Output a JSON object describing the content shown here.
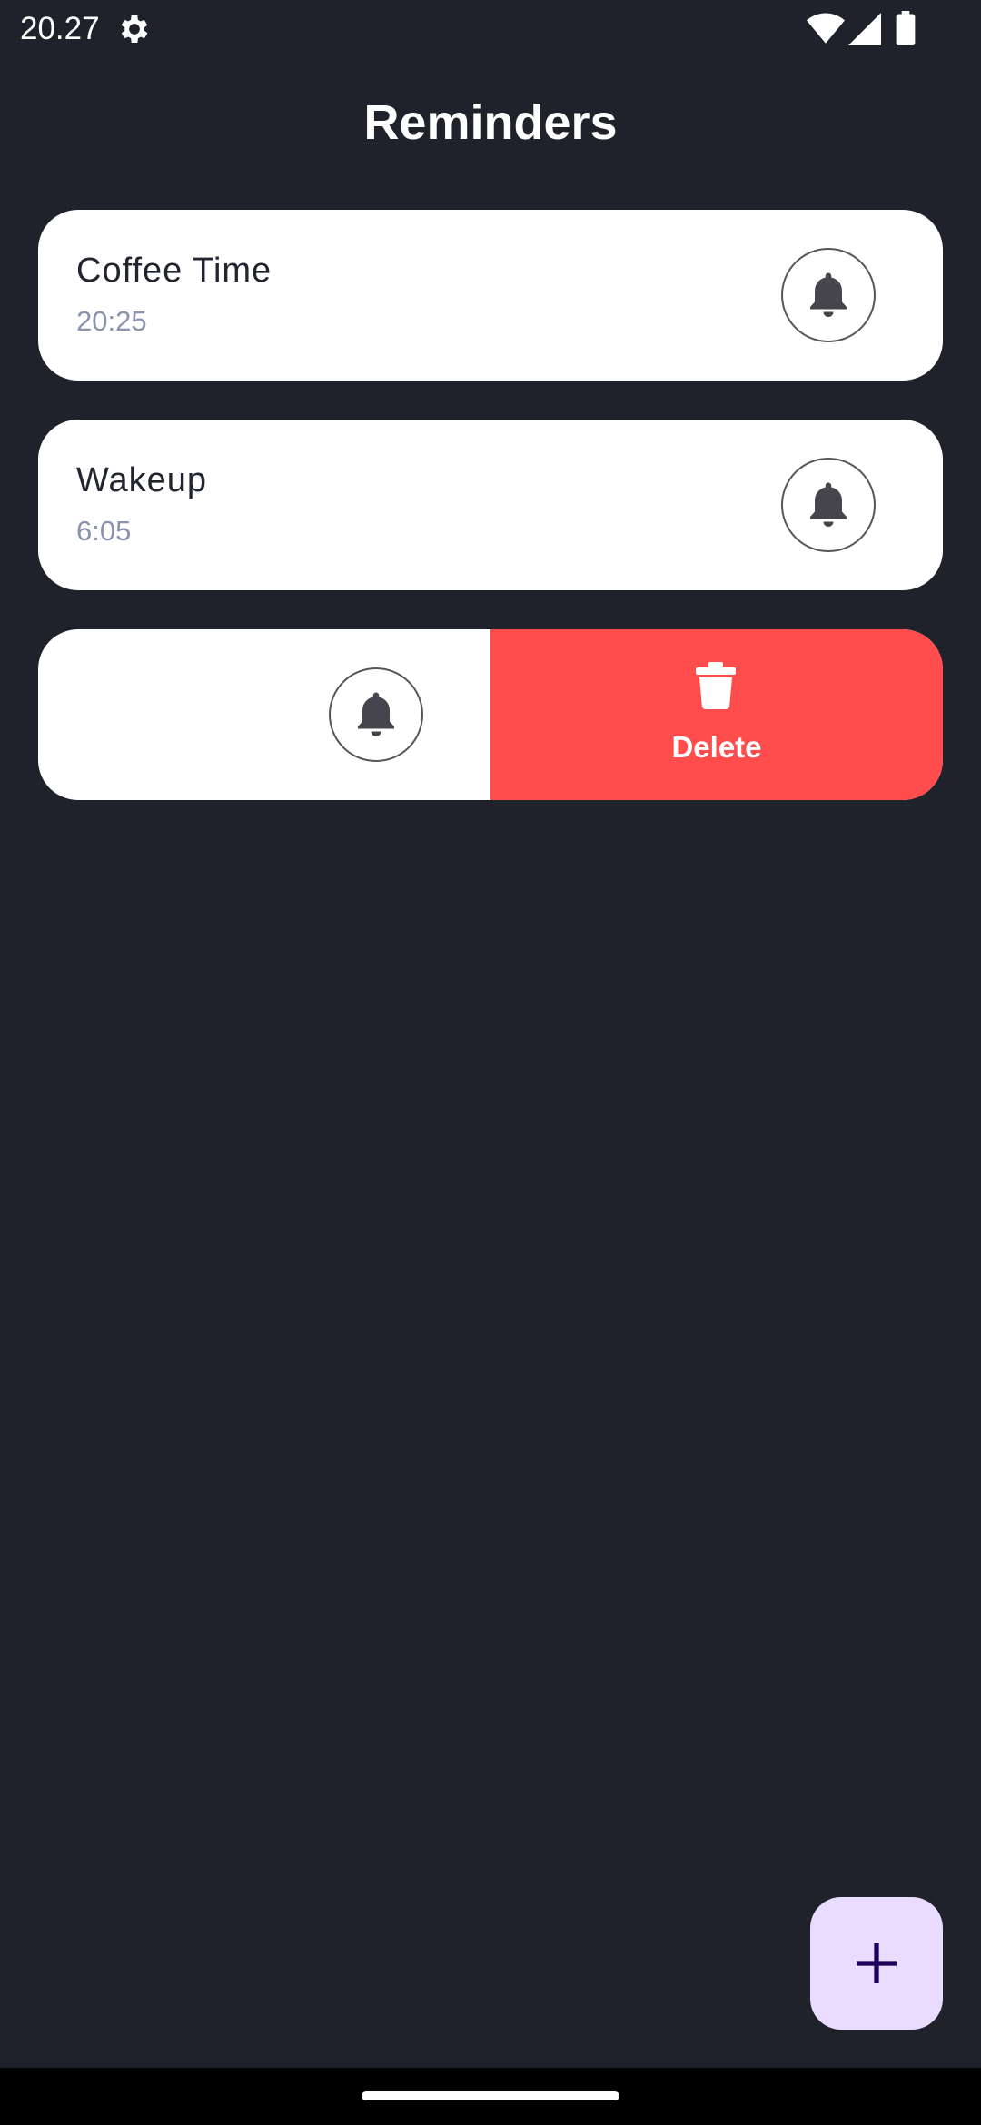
{
  "status_bar": {
    "time": "20.27",
    "icons": [
      "settings-gear-icon",
      "wifi-icon",
      "cellular-signal-icon",
      "battery-icon"
    ]
  },
  "header": {
    "title": "Reminders"
  },
  "reminders": [
    {
      "name": "Coffee Time",
      "time": "20:25",
      "icon": "bell-icon"
    },
    {
      "name": "Wakeup",
      "time": "6:05",
      "icon": "bell-icon"
    },
    {
      "name": "",
      "time": "",
      "icon": "bell-icon",
      "swiped": true
    }
  ],
  "swipe_action": {
    "label": "Delete",
    "icon": "trash-icon",
    "color": "#ff4c4c"
  },
  "fab": {
    "icon": "plus-icon",
    "color": "#eadcff"
  },
  "colors": {
    "background": "#1f222a",
    "card": "#ffffff",
    "name_text": "#222530",
    "time_text": "#8a93ad",
    "delete": "#ff4c4c",
    "fab": "#eadcff"
  }
}
